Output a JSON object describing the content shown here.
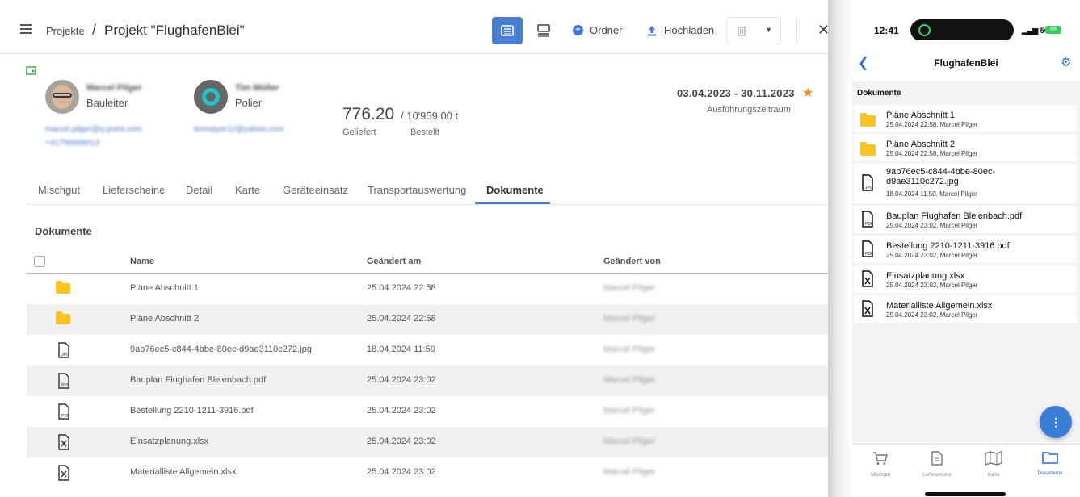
{
  "desktop": {
    "breadcrumb": {
      "root": "Projekte",
      "separator": "/",
      "current": "Projekt \"FlughafenBlei\""
    },
    "toolbar": {
      "folder_label": "Ordner",
      "upload_label": "Hochladen"
    },
    "people": [
      {
        "name": "Marcel Pilger",
        "role": "Bauleiter",
        "email": "marcel.pilger@q-point.com",
        "phone": "+41796689013"
      },
      {
        "name": "Tim Müller",
        "role": "Polier",
        "email": "timmayer12@yahoo.com"
      }
    ],
    "quantity": {
      "delivered": "776.20",
      "ordered": "/ 10'959.00 t",
      "delivered_label": "Geliefert",
      "ordered_label": "Bestellt"
    },
    "period": {
      "range": "03.04.2023 - 30.11.2023",
      "label": "Ausführungszeitraum"
    },
    "tabs": [
      "Mischgut",
      "Lieferscheine",
      "Detail",
      "Karte",
      "Geräteeinsatz",
      "Transportauswertung",
      "Dokumente"
    ],
    "active_tab": "Dokumente",
    "documents_title": "Dokumente",
    "columns": {
      "name": "Name",
      "changed_at": "Geändert am",
      "changed_by": "Geändert von"
    },
    "rows": [
      {
        "type": "folder",
        "name": "Pläne Abschnitt 1",
        "date": "25.04.2024 22:58",
        "by": "Marcel Pilger"
      },
      {
        "type": "folder",
        "name": "Pläne Abschnitt 2",
        "date": "25.04.2024 22:58",
        "by": "Marcel Pilger"
      },
      {
        "type": "jpg",
        "name": "9ab76ec5-c844-4bbe-80ec-d9ae3110c272.jpg",
        "date": "18.04.2024 11:50",
        "by": "Marcel Pilger"
      },
      {
        "type": "pdf",
        "name": "Bauplan Flughafen Bleienbach.pdf",
        "date": "25.04.2024 23:02",
        "by": "Marcel Pilger"
      },
      {
        "type": "pdf",
        "name": "Bestellung 2210-1211-3916.pdf",
        "date": "25.04.2024 23:02",
        "by": "Marcel Pilger"
      },
      {
        "type": "xlsx",
        "name": "Einsatzplanung.xlsx",
        "date": "25.04.2024 23:02",
        "by": "Marcel Pilger"
      },
      {
        "type": "xlsx",
        "name": "Materialliste Allgemein.xlsx",
        "date": "25.04.2024 23:02",
        "by": "Marcel Pilger"
      }
    ]
  },
  "mobile": {
    "time": "12:41",
    "signal": "5G",
    "battery": "69",
    "title": "FlughafenBlei",
    "section": "Dokumente",
    "items": [
      {
        "type": "folder",
        "name": "Pläne Abschnitt 1",
        "meta": "25.04.2024 22:58, Marcel Pilger"
      },
      {
        "type": "folder",
        "name": "Pläne Abschnitt 2",
        "meta": "25.04.2024 22:58, Marcel Pilger"
      },
      {
        "type": "jpg",
        "name": "9ab76ec5-c844-4bbe-80ec-d9ae3110c272.jpg",
        "meta": "18.04.2024 11:50, Marcel Pilger"
      },
      {
        "type": "pdf",
        "name": "Bauplan Flughafen Bleienbach.pdf",
        "meta": "25.04.2024 23:02, Marcel Pilger"
      },
      {
        "type": "pdf",
        "name": "Bestellung 2210-1211-3916.pdf",
        "meta": "25.04.2024 23:02, Marcel Pilger"
      },
      {
        "type": "xlsx",
        "name": "Einsatzplanung.xlsx",
        "meta": "25.04.2024 23:02, Marcel Pilger"
      },
      {
        "type": "xlsx",
        "name": "Materialliste Allgemein.xlsx",
        "meta": "25.04.2024 23:02, Marcel Pilger"
      }
    ],
    "fab_label": "⋮",
    "bottom_nav": [
      {
        "label": "Mischgut",
        "icon": "cart-icon"
      },
      {
        "label": "Lieferscheine",
        "icon": "document-icon"
      },
      {
        "label": "Karte",
        "icon": "map-icon"
      },
      {
        "label": "Dokumente",
        "icon": "folder-icon",
        "active": true
      }
    ]
  },
  "colors": {
    "accent": "#4a7fd0",
    "folder": "#f7c325",
    "star": "#f08a24",
    "link": "#2f6fd6"
  }
}
